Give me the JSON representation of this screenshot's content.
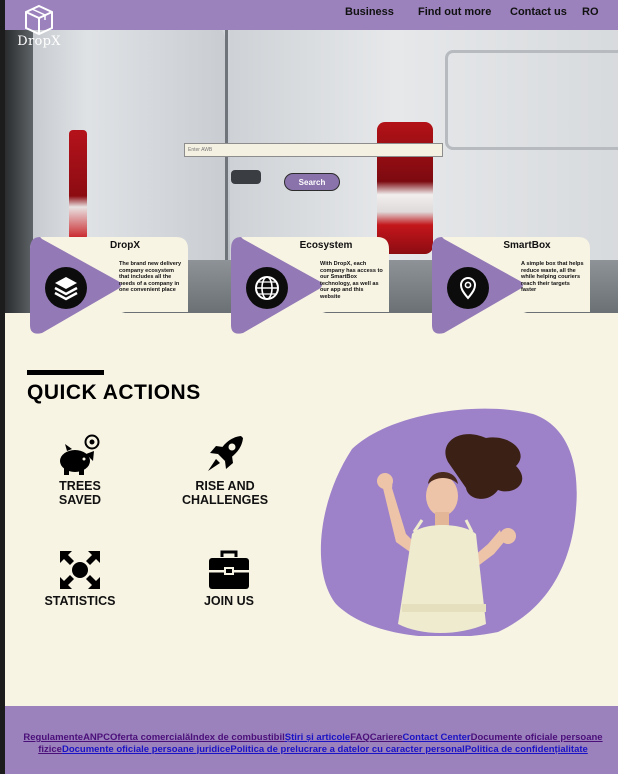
{
  "header": {
    "logo_text": "DropX",
    "nav": [
      {
        "label": "Business"
      },
      {
        "label": "Find out more"
      },
      {
        "label": "Contact us"
      },
      {
        "label": "RO"
      }
    ]
  },
  "hero": {
    "search_placeholder": "Enter AWB",
    "search_button": "Search"
  },
  "cards": [
    {
      "title": "DropX",
      "icon": "layers-icon",
      "description": "The brand new delivery company ecosystem that includes all the needs of a company in one convenient place"
    },
    {
      "title": "Ecosystem",
      "icon": "globe-icon",
      "description": "With DropX, each company has access to our SmartBox technology, as well as our app and this website"
    },
    {
      "title": "SmartBox",
      "icon": "location-pin-icon",
      "description": "A simple box that helps reduce waste, all the while helping couriers reach their targets faster"
    }
  ],
  "quick_actions": {
    "title": "QUICK ACTIONS",
    "items": [
      {
        "label_line1": "TREES",
        "label_line2": "SAVED",
        "icon": "piggy-bank-icon"
      },
      {
        "label_line1": "RISE AND",
        "label_line2": "CHALLENGES",
        "icon": "rocket-icon"
      },
      {
        "label_line1": "STATISTICS",
        "label_line2": "",
        "icon": "arrows-icon"
      },
      {
        "label_line1": "JOIN US",
        "label_line2": "",
        "icon": "toolbox-icon"
      }
    ]
  },
  "footer": {
    "links": [
      "Regulamente",
      "ANPC",
      "Oferta comercială",
      "Index de combustibil",
      "Știri și articole",
      "FAQ",
      "Cariere",
      "Contact Center",
      "Documente oficiale persoane fizice",
      "Documente oficiale persoane juridice",
      "Politica de prelucrare a datelor cu caracter personal",
      "Politica de confidențialitate"
    ]
  },
  "colors": {
    "brand_purple": "#9b82bc",
    "background": "#f8f4e4",
    "card_purple": "#9379b6",
    "card_cream": "#f8f4e4"
  }
}
